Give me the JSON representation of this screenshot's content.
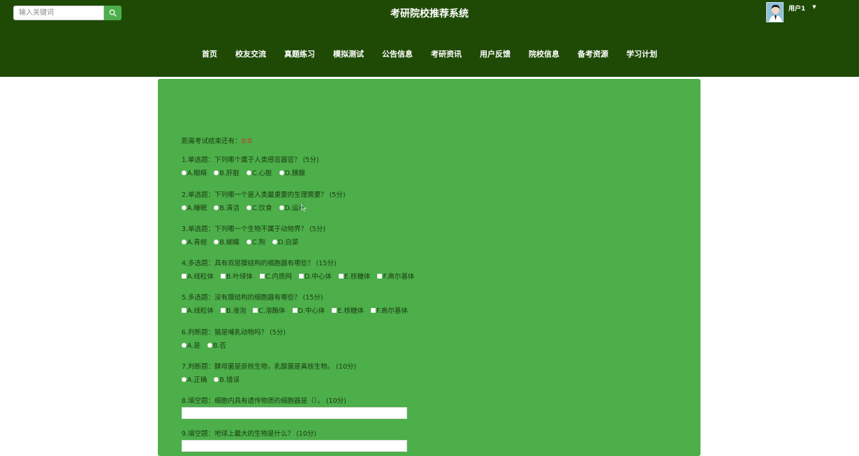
{
  "search": {
    "placeholder": "输入关键词"
  },
  "header": {
    "title": "考研院校推荐系统",
    "user_name": "用户1"
  },
  "nav": [
    "首页",
    "校友交流",
    "真题练习",
    "模拟测试",
    "公告信息",
    "考研资讯",
    "用户反馈",
    "院校信息",
    "备考资源",
    "学习计划"
  ],
  "exam": {
    "timer_label": "距离考试结束还有：",
    "timer_value": "0:0",
    "questions": [
      {
        "title": "1.单选题：下列哪个属于人类感官器官？ (5分)",
        "type": "radio",
        "options": [
          "A.眼睛",
          "B.肝脏",
          "C.心脏",
          "D.胰腺"
        ]
      },
      {
        "title": "2.单选题：下列哪一个是人类最重要的生理需要？ (5分)",
        "type": "radio",
        "options": [
          "A.睡眠",
          "B.清洁",
          "C.饮食",
          "D.运动"
        ]
      },
      {
        "title": "3.单选题：下列哪一个生物不属于动物界？ (5分)",
        "type": "radio",
        "options": [
          "A.青蛙",
          "B.蝴蝶",
          "C.狗",
          "D.白菜"
        ]
      },
      {
        "title": "4.多选题：具有双层膜结构的细胞器有哪些？ (15分)",
        "type": "checkbox",
        "options": [
          "A.线粒体",
          "B.叶绿体",
          "C.内质网",
          "D.中心体",
          "E.核糖体",
          "F.高尔基体"
        ]
      },
      {
        "title": "5.多选题：没有膜结构的细胞器有哪些？ (15分)",
        "type": "checkbox",
        "options": [
          "A.线粒体",
          "B.液泡",
          "C.溶酶体",
          "D.中心体",
          "E.核糖体",
          "F.高尔基体"
        ]
      },
      {
        "title": "6.判断题：猫是哺乳动物吗？ (5分)",
        "type": "radio",
        "options": [
          "A.是",
          "B.否"
        ]
      },
      {
        "title": "7.判断题：酵母菌是原核生物，乳酸菌是真核生物。 (10分)",
        "type": "radio",
        "options": [
          "A.正确",
          "B.错误"
        ]
      },
      {
        "title": "8.填空题：细胞内具有遗传物质的细胞器是（）。 (10分)",
        "type": "fill",
        "options": []
      },
      {
        "title": "9.填空题：地球上最大的生物是什么？ (10分)",
        "type": "fill",
        "options": []
      }
    ]
  },
  "colors": {
    "header_bg": "#1f4a05",
    "panel_bg": "#4caf4a",
    "search_button": "#4cae4c",
    "timer_value": "#d8232a"
  }
}
